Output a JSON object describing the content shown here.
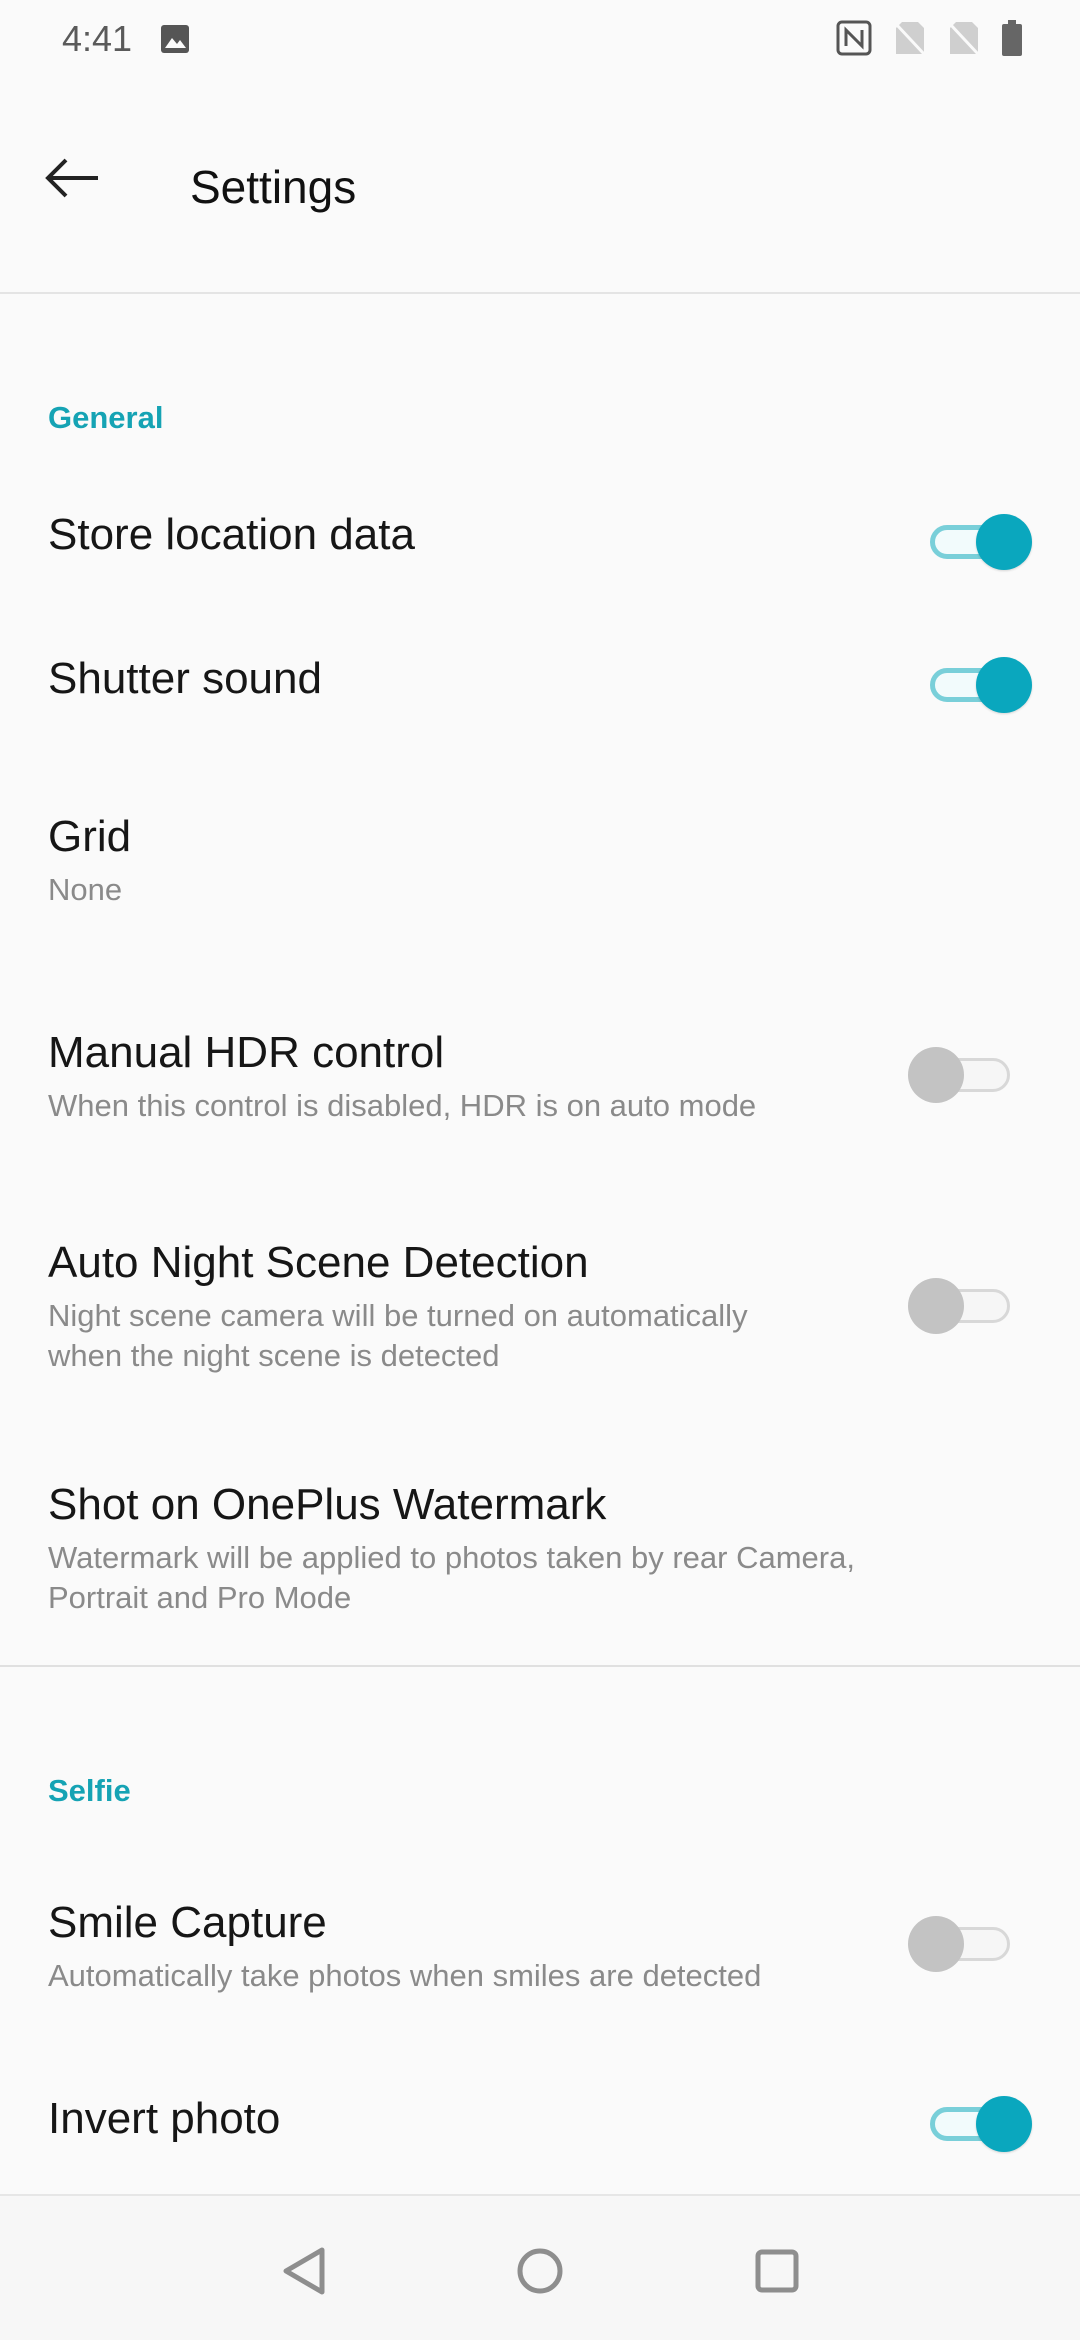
{
  "status_bar": {
    "time": "4:41",
    "icons": [
      "image-icon",
      "nfc-icon",
      "sim-no-signal-icon",
      "sim-no-signal-icon",
      "battery-icon"
    ]
  },
  "app_bar": {
    "title": "Settings",
    "back_icon": "arrow-left-icon"
  },
  "sections": {
    "general": {
      "header": "General",
      "store_location": {
        "label": "Store location data",
        "enabled": true
      },
      "shutter_sound": {
        "label": "Shutter sound",
        "enabled": true
      },
      "grid": {
        "label": "Grid",
        "value": "None"
      },
      "manual_hdr": {
        "label": "Manual HDR control",
        "summary": "When this control is disabled, HDR is on auto mode",
        "enabled": false
      },
      "auto_night": {
        "label": "Auto Night Scene Detection",
        "summary_line1": "Night scene camera will be turned on automatically",
        "summary_line2": "when the night scene is detected",
        "enabled": false
      },
      "watermark": {
        "label": "Shot on OnePlus Watermark",
        "summary_line1": "Watermark will be applied to photos taken by rear Camera,",
        "summary_line2": "Portrait and Pro Mode"
      }
    },
    "selfie": {
      "header": "Selfie",
      "smile_capture": {
        "label": "Smile Capture",
        "summary": "Automatically take photos when smiles are detected",
        "enabled": false
      },
      "invert_photo": {
        "label": "Invert photo",
        "enabled": true
      }
    }
  },
  "colors": {
    "accent": "#15a3b4",
    "toggle_on_knob": "#0aa7be",
    "toggle_off_knob": "#c3c3c3"
  },
  "nav_bar": {
    "icons": [
      "nav-back-triangle-icon",
      "nav-home-circle-icon",
      "nav-recents-square-icon"
    ]
  }
}
